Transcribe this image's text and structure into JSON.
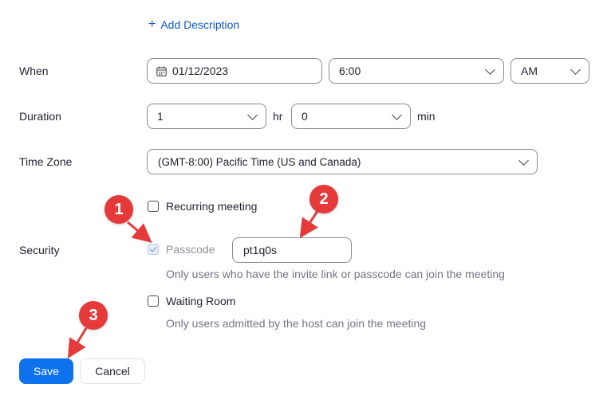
{
  "add_description": {
    "icon": "plus-icon",
    "label": "Add Description"
  },
  "when": {
    "label": "When",
    "date": "01/12/2023",
    "time": "6:00",
    "ampm": "AM"
  },
  "duration": {
    "label": "Duration",
    "hours": "1",
    "hours_unit": "hr",
    "minutes": "0",
    "minutes_unit": "min"
  },
  "timezone": {
    "label": "Time Zone",
    "value": "(GMT-8:00) Pacific Time (US and Canada)"
  },
  "security": {
    "label": "Security",
    "recurring_label": "Recurring meeting",
    "recurring_checked": false,
    "passcode_label": "Passcode",
    "passcode_checked": true,
    "passcode_value": "pt1q0s",
    "passcode_help": "Only users who have the invite link or passcode can join the meeting",
    "waiting_room_label": "Waiting Room",
    "waiting_room_checked": false,
    "waiting_room_help": "Only users admitted by the host can join the meeting"
  },
  "actions": {
    "save_label": "Save",
    "cancel_label": "Cancel"
  },
  "annotations": [
    "1",
    "2",
    "3"
  ],
  "colors": {
    "accent": "#0e72ed",
    "link": "#0e5ac8",
    "annotation": "#e63a3a"
  }
}
